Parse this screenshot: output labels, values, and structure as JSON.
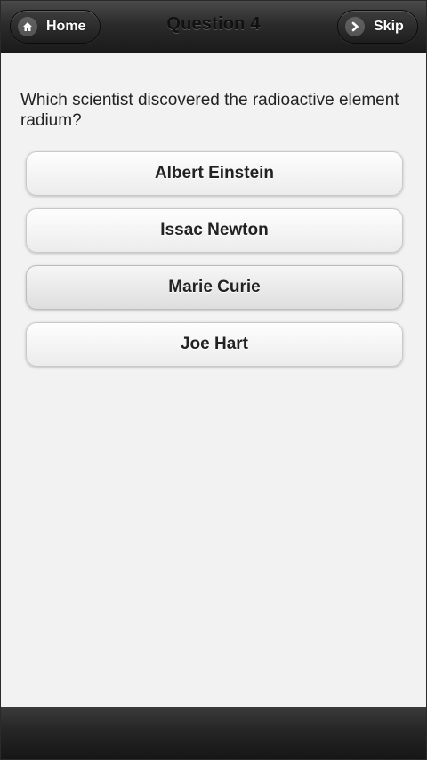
{
  "header": {
    "title": "Question 4",
    "home_label": "Home",
    "skip_label": "Skip"
  },
  "question": {
    "text": "Which scientist discovered the radioactive element radium?"
  },
  "answers": [
    {
      "label": "Albert Einstein"
    },
    {
      "label": "Issac Newton"
    },
    {
      "label": "Marie Curie"
    },
    {
      "label": "Joe Hart"
    }
  ],
  "icons": {
    "home": "home-icon",
    "skip": "chevron-right-icon"
  },
  "colors": {
    "bar_dark": "#1a1a1a",
    "page_bg": "#f2f2f2",
    "button_text": "#222222"
  }
}
